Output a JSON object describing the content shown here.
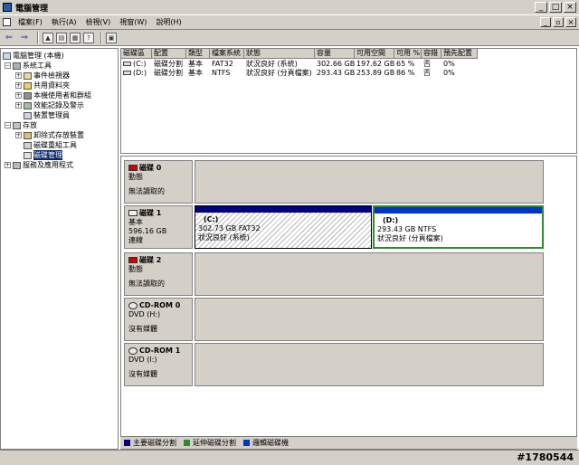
{
  "window": {
    "title": "電腦管理"
  },
  "menubar": {
    "items": [
      "檔案(F)",
      "執行(A)",
      "檢視(V)",
      "視窗(W)",
      "說明(H)"
    ]
  },
  "toolbar": {
    "icons": [
      "back-arrow-icon",
      "forward-arrow-icon",
      "up-folder-icon",
      "show-tree-icon",
      "properties-icon",
      "help-icon",
      "console-icon"
    ]
  },
  "tree": {
    "items": [
      {
        "label": "電腦管理 (本機)",
        "level": 0,
        "expander": ""
      },
      {
        "label": "系統工具",
        "level": 1,
        "expander": "-"
      },
      {
        "label": "事件檢視器",
        "level": 2,
        "expander": "+"
      },
      {
        "label": "共用資料夾",
        "level": 2,
        "expander": "+"
      },
      {
        "label": "本機使用者和群組",
        "level": 2,
        "expander": "+"
      },
      {
        "label": "效能記錄及警示",
        "level": 2,
        "expander": "+"
      },
      {
        "label": "裝置管理員",
        "level": 2,
        "expander": ""
      },
      {
        "label": "存放",
        "level": 1,
        "expander": "-"
      },
      {
        "label": "卸除式存放裝置",
        "level": 2,
        "expander": "+"
      },
      {
        "label": "磁碟重組工具",
        "level": 2,
        "expander": ""
      },
      {
        "label": "磁碟管理",
        "level": 2,
        "expander": "",
        "selected": true
      },
      {
        "label": "服務及應用程式",
        "level": 1,
        "expander": "+"
      }
    ]
  },
  "volume_list": {
    "columns": [
      "磁碟區",
      "配置",
      "類型",
      "檔案系統",
      "狀態",
      "容量",
      "可用空間",
      "可用 %",
      "容錯",
      "預先配置"
    ],
    "rows": [
      [
        "(C:)",
        "磁碟分割",
        "基本",
        "FAT32",
        "狀況良好 (系統)",
        "302.66 GB",
        "197.62 GB",
        "65 %",
        "否",
        "0%"
      ],
      [
        "(D:)",
        "磁碟分割",
        "基本",
        "NTFS",
        "狀況良好 (分頁檔案)",
        "293.43 GB",
        "253.89 GB",
        "86 %",
        "否",
        "0%"
      ]
    ]
  },
  "disks": [
    {
      "name": "磁碟 0",
      "type": "動態",
      "size": "",
      "status": "無法讀取的",
      "icon": "disk-error-icon"
    },
    {
      "name": "磁碟 1",
      "type": "基本",
      "size": "596.16 GB",
      "status": "連線",
      "icon": "disk-icon",
      "partitions": [
        {
          "label": "(C:)",
          "detail": "302.73 GB FAT32",
          "status": "狀況良好 (系統)"
        },
        {
          "label": "(D:)",
          "detail": "293.43 GB NTFS",
          "status": "狀況良好 (分頁檔案)"
        }
      ]
    },
    {
      "name": "磁碟 2",
      "type": "動態",
      "size": "",
      "status": "無法讀取的",
      "icon": "disk-error-icon"
    },
    {
      "name": "CD-ROM 0",
      "type": "DVD (H:)",
      "size": "",
      "status": "沒有媒體",
      "icon": "cdrom-icon"
    },
    {
      "name": "CD-ROM 1",
      "type": "DVD (I:)",
      "size": "",
      "status": "沒有媒體",
      "icon": "cdrom-icon"
    }
  ],
  "legend": {
    "items": [
      {
        "label": "主要磁碟分割",
        "color": "#000080"
      },
      {
        "label": "延伸磁碟分割",
        "color": "#2e8b2e"
      },
      {
        "label": "邏輯磁碟機",
        "color": "#0033cc"
      }
    ]
  },
  "watermark": "#1780544"
}
